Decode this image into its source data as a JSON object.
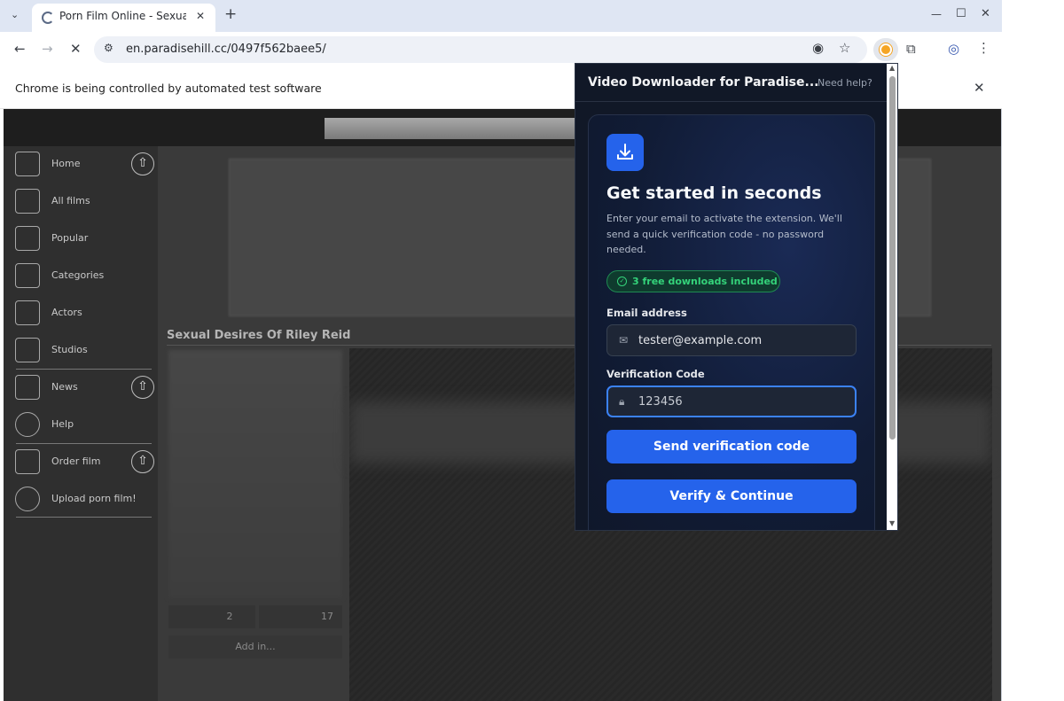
{
  "browser": {
    "tab_title": "Porn Film Online - Sexual",
    "new_tab_symbol": "+",
    "url": "en.paradisehill.cc/0497f562baee5/",
    "infobar_text": "Chrome is being controlled by automated test software",
    "window_controls": {
      "minimize": "—",
      "maximize": "☐",
      "close": "✕"
    }
  },
  "site": {
    "nav": [
      {
        "label": "Home",
        "icon": "house-icon"
      },
      {
        "label": "All films",
        "icon": "film-icon"
      },
      {
        "label": "Popular",
        "icon": "star-icon"
      },
      {
        "label": "Categories",
        "icon": "categories-icon"
      },
      {
        "label": "Actors",
        "icon": "masks-icon"
      },
      {
        "label": "Studios",
        "icon": "camera-icon"
      },
      {
        "label": "News",
        "icon": "newspaper-icon"
      },
      {
        "label": "Help",
        "icon": "question-icon"
      },
      {
        "label": "Order film",
        "icon": "ticket-icon"
      },
      {
        "label": "Upload porn film!",
        "icon": "cloud-upload-icon"
      }
    ],
    "page_title": "Sexual Desires Of Riley Reid",
    "stats": [
      "2",
      "17"
    ],
    "add_in_label": "Add in..."
  },
  "extension": {
    "title": "Video Downloader for Paradise...",
    "help_link": "Need help?",
    "headline": "Get started in seconds",
    "description": "Enter your email to activate the extension. We'll send a quick verification code - no password needed.",
    "badge": "3 free downloads included",
    "email_label": "Email address",
    "email_value": "tester@example.com",
    "code_label": "Verification Code",
    "code_value": "123456",
    "send_button": "Send verification code",
    "verify_button": "Verify & Continue",
    "accent_color": "#2563eb",
    "badge_color": "#34d37a"
  }
}
